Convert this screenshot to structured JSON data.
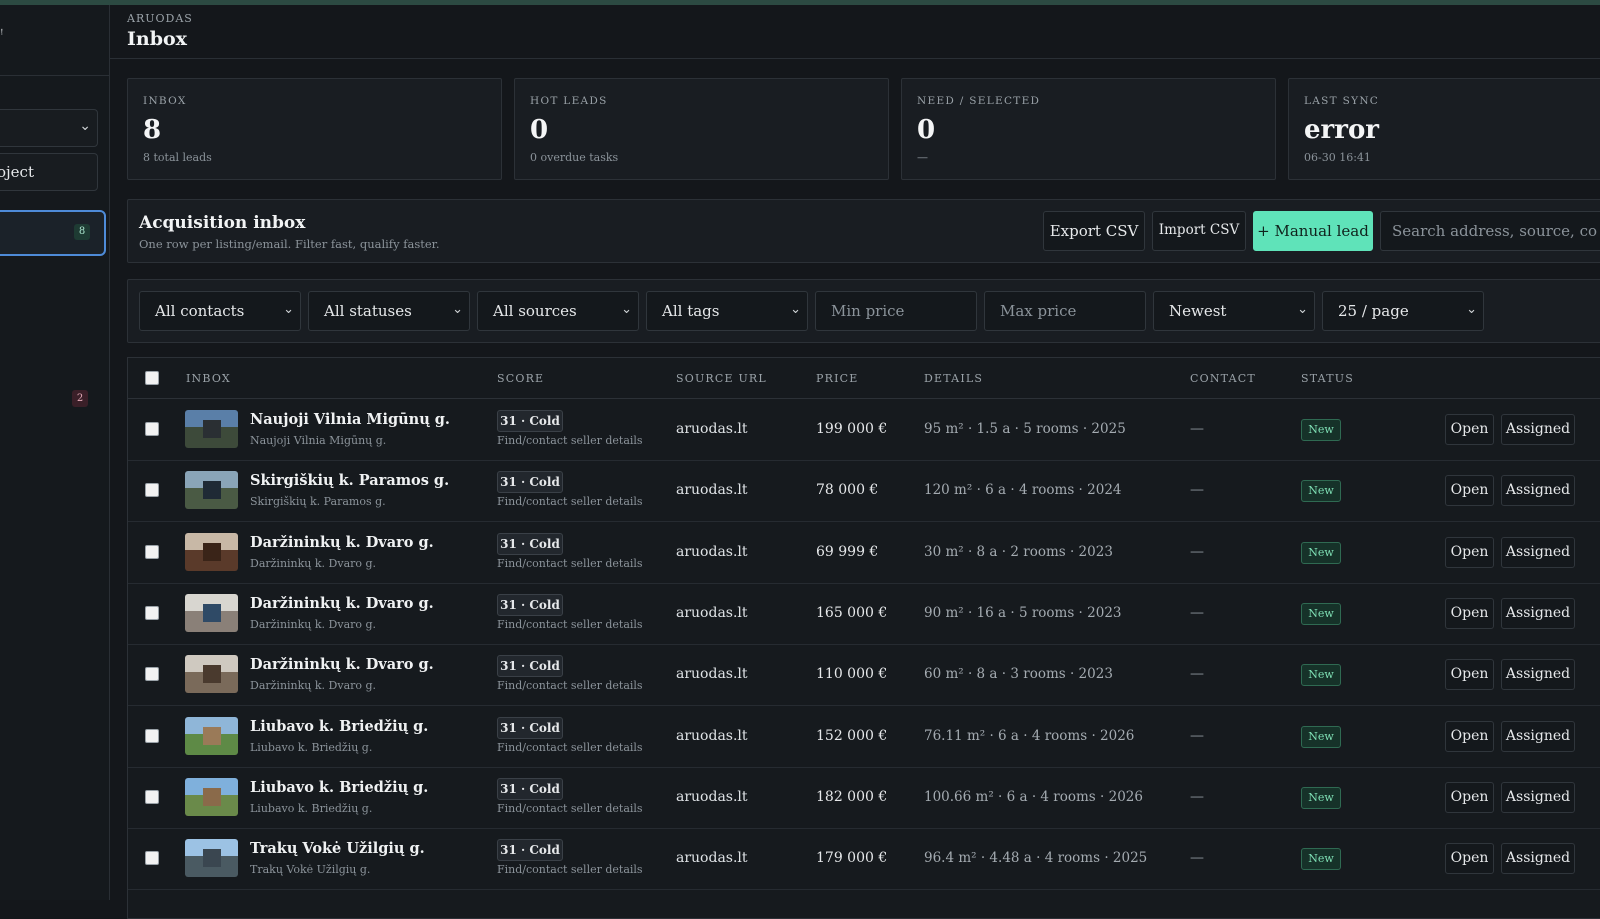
{
  "sidebar": {
    "mark": "ꜝ",
    "project_field_fragment": "oject",
    "active_item_count": "8",
    "secondary_count": "2"
  },
  "header": {
    "crumb": "ARUODAS",
    "title": "Inbox"
  },
  "stats": [
    {
      "label": "INBOX",
      "value": "8",
      "sub": "8 total leads"
    },
    {
      "label": "HOT LEADS",
      "value": "0",
      "sub": "0 overdue tasks"
    },
    {
      "label": "NEED / SELECTED",
      "value": "0",
      "sub": "—"
    },
    {
      "label": "LAST SYNC",
      "value": "error",
      "sub": "06-30 16:41"
    }
  ],
  "toolbar": {
    "title": "Acquisition inbox",
    "subtitle": "One row per listing/email. Filter fast, qualify faster.",
    "export_label": "Export CSV",
    "import_label": "Import CSV",
    "manual_label": "+ Manual lead",
    "search_placeholder": "Search address, source, co"
  },
  "filters": {
    "contacts": "All contacts",
    "statuses": "All statuses",
    "sources": "All sources",
    "tags": "All tags",
    "min_price": "Min price",
    "max_price": "Max price",
    "sort": "Newest",
    "per_page": "25 / page"
  },
  "table": {
    "headers": {
      "inbox": "INBOX",
      "score": "SCORE",
      "source": "SOURCE URL",
      "price": "PRICE",
      "details": "DETAILS",
      "contact": "CONTACT",
      "status": "STATUS"
    },
    "rows": [
      {
        "name": "Naujoji Vilnia Migūnų g.",
        "addr": "Naujoji Vilnia Migūnų g.",
        "score": "31 · Cold",
        "hint": "Find/contact seller details",
        "source": "aruodas.lt",
        "price": "199 000 €",
        "details": "95 m² · 1.5 a · 5 rooms · 2025",
        "contact": "—",
        "status": "New",
        "open": "Open",
        "assign": "Assigned",
        "thumb_sky": "#5a7fa8",
        "thumb_ground": "#3d4a3a",
        "thumb_obj": "#2a2f33"
      },
      {
        "name": "Skirgiškių k. Paramos g.",
        "addr": "Skirgiškių k. Paramos g.",
        "score": "31 · Cold",
        "hint": "Find/contact seller details",
        "source": "aruodas.lt",
        "price": "78 000 €",
        "details": "120 m² · 6 a · 4 rooms · 2024",
        "contact": "—",
        "status": "New",
        "open": "Open",
        "assign": "Assigned",
        "thumb_sky": "#8aa5b8",
        "thumb_ground": "#4a5a44",
        "thumb_obj": "#1f2a35"
      },
      {
        "name": "Daržininkų k. Dvaro g.",
        "addr": "Daržininkų k. Dvaro g.",
        "score": "31 · Cold",
        "hint": "Find/contact seller details",
        "source": "aruodas.lt",
        "price": "69 999 €",
        "details": "30 m² · 8 a · 2 rooms · 2023",
        "contact": "—",
        "status": "New",
        "open": "Open",
        "assign": "Assigned",
        "thumb_sky": "#c8b8a6",
        "thumb_ground": "#5a3a2a",
        "thumb_obj": "#3a2418"
      },
      {
        "name": "Daržininkų k. Dvaro g.",
        "addr": "Daržininkų k. Dvaro g.",
        "score": "31 · Cold",
        "hint": "Find/contact seller details",
        "source": "aruodas.lt",
        "price": "165 000 €",
        "details": "90 m² · 16 a · 5 rooms · 2023",
        "contact": "—",
        "status": "New",
        "open": "Open",
        "assign": "Assigned",
        "thumb_sky": "#d8d6d0",
        "thumb_ground": "#8a8078",
        "thumb_obj": "#2f4a66"
      },
      {
        "name": "Daržininkų k. Dvaro g.",
        "addr": "Daržininkų k. Dvaro g.",
        "score": "31 · Cold",
        "hint": "Find/contact seller details",
        "source": "aruodas.lt",
        "price": "110 000 €",
        "details": "60 m² · 8 a · 3 rooms · 2023",
        "contact": "—",
        "status": "New",
        "open": "Open",
        "assign": "Assigned",
        "thumb_sky": "#cfc9c0",
        "thumb_ground": "#7a6a5a",
        "thumb_obj": "#4a3a2e"
      },
      {
        "name": "Liubavo k. Briedžių g.",
        "addr": "Liubavo k. Briedžių g.",
        "score": "31 · Cold",
        "hint": "Find/contact seller details",
        "source": "aruodas.lt",
        "price": "152 000 €",
        "details": "76.11 m² · 6 a · 4 rooms · 2026",
        "contact": "—",
        "status": "New",
        "open": "Open",
        "assign": "Assigned",
        "thumb_sky": "#8fb6d8",
        "thumb_ground": "#5e8a46",
        "thumb_obj": "#9a7a58"
      },
      {
        "name": "Liubavo k. Briedžių g.",
        "addr": "Liubavo k. Briedžių g.",
        "score": "31 · Cold",
        "hint": "Find/contact seller details",
        "source": "aruodas.lt",
        "price": "182 000 €",
        "details": "100.66 m² · 6 a · 4 rooms · 2026",
        "contact": "—",
        "status": "New",
        "open": "Open",
        "assign": "Assigned",
        "thumb_sky": "#7fb0dc",
        "thumb_ground": "#6a8a4a",
        "thumb_obj": "#8a6a4a"
      },
      {
        "name": "Trakų Vokė Užilgių g.",
        "addr": "Trakų Vokė Užilgių g.",
        "score": "31 · Cold",
        "hint": "Find/contact seller details",
        "source": "aruodas.lt",
        "price": "179 000 €",
        "details": "96.4 m² · 4.48 a · 4 rooms · 2025",
        "contact": "—",
        "status": "New",
        "open": "Open",
        "assign": "Assigned",
        "thumb_sky": "#9cc2e4",
        "thumb_ground": "#4a5a62",
        "thumb_obj": "#3a4650"
      }
    ]
  }
}
